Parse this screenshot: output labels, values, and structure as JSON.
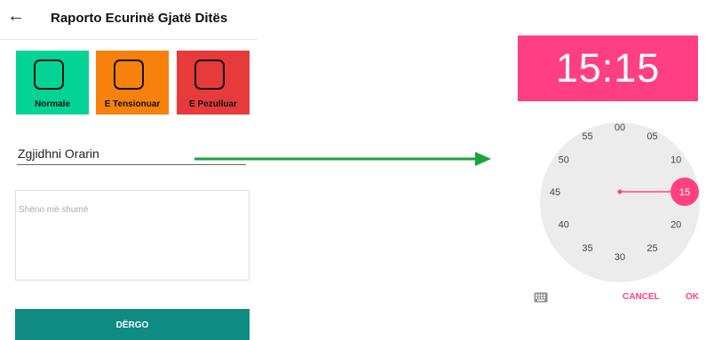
{
  "header": {
    "back_icon": "back-arrow-icon",
    "title": "Raporto Ecurinë Gjatë Ditës"
  },
  "status_tiles": [
    {
      "label": "Normale",
      "color": "#03d495"
    },
    {
      "label": "E Tensionuar",
      "color": "#f8810d"
    },
    {
      "label": "E Pezulluar",
      "color": "#e63a3b"
    }
  ],
  "time_field": {
    "label": "Zgjidhni Orarin"
  },
  "notes": {
    "placeholder": "Shëno më shumë"
  },
  "submit": {
    "label": "DËRGO"
  },
  "connector_arrow_color": "#1aa33f",
  "time_picker": {
    "time": "15:15",
    "accent_color": "#ff4081",
    "selected_minute": "15",
    "dial_labels": [
      "00",
      "05",
      "10",
      "15",
      "20",
      "25",
      "30",
      "35",
      "40",
      "45",
      "50",
      "55"
    ],
    "keyboard_icon": "keyboard-icon",
    "cancel_label": "CANCEL",
    "ok_label": "OK"
  }
}
